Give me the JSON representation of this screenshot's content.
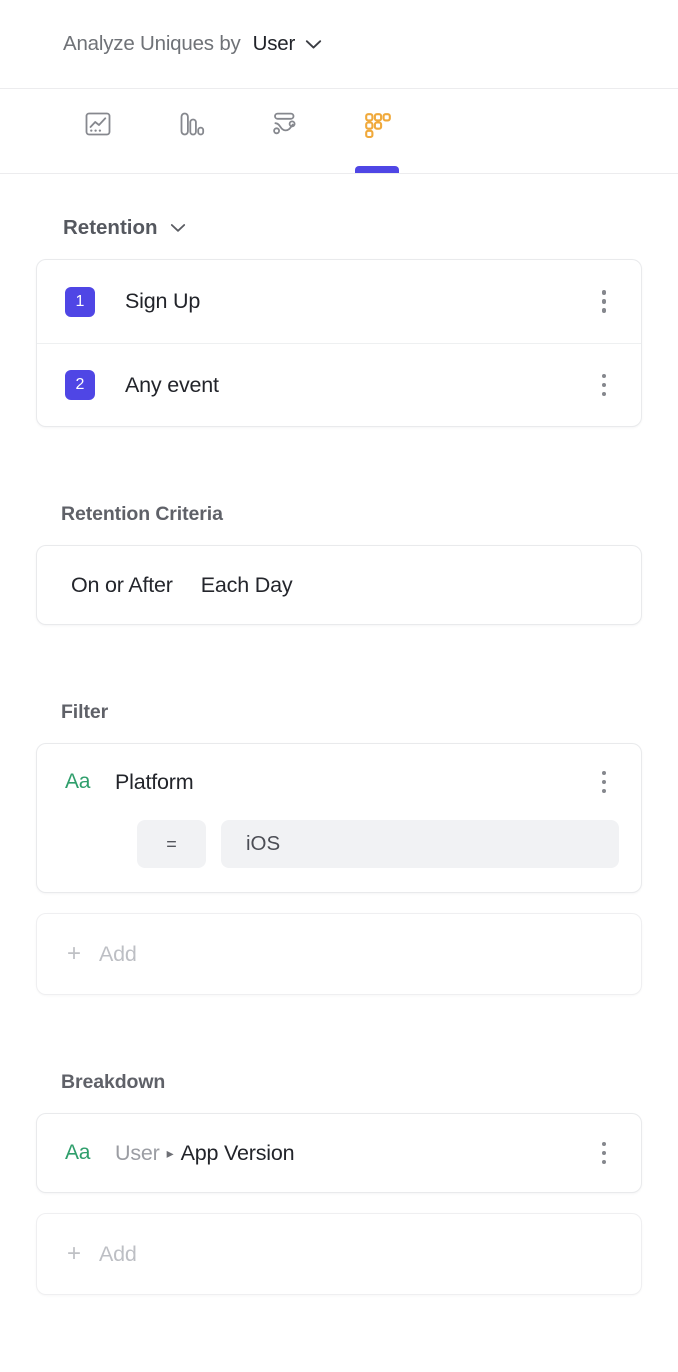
{
  "header": {
    "label": "Analyze Uniques by",
    "value": "User",
    "chevron_icon": "chevron-down-icon"
  },
  "tabs": [
    {
      "id": "line-chart",
      "icon": "line-chart-icon",
      "active": false
    },
    {
      "id": "funnel",
      "icon": "funnel-bars-icon",
      "active": false
    },
    {
      "id": "journeys",
      "icon": "flow-path-icon",
      "active": false
    },
    {
      "id": "retention",
      "icon": "retention-grid-icon",
      "active": true
    }
  ],
  "retention": {
    "title": "Retention",
    "chevron_icon": "chevron-down-icon",
    "steps": [
      {
        "number": "1",
        "label": "Sign Up",
        "menu_icon": "kebab-menu-icon"
      },
      {
        "number": "2",
        "label": "Any event",
        "menu_icon": "kebab-menu-icon"
      }
    ]
  },
  "retention_criteria": {
    "title": "Retention Criteria",
    "operator": "On or After",
    "interval": "Each Day"
  },
  "filter": {
    "title": "Filter",
    "items": [
      {
        "type_icon": "Aa",
        "property": "Platform",
        "operator": "=",
        "value": "iOS",
        "menu_icon": "kebab-menu-icon"
      }
    ],
    "add": {
      "plus": "+",
      "label": "Add"
    }
  },
  "breakdown": {
    "title": "Breakdown",
    "items": [
      {
        "type_icon": "Aa",
        "scope": "User",
        "separator": "▸",
        "property": "App Version",
        "menu_icon": "kebab-menu-icon"
      }
    ],
    "add": {
      "plus": "+",
      "label": "Add"
    }
  },
  "colors": {
    "accent_indigo": "#4f46e5",
    "retention_amber": "#f0a93b",
    "type_green": "#2e9e6b",
    "border_gray": "#e9eaec",
    "chip_gray": "#f1f2f4",
    "muted_text": "#bdbfc4"
  }
}
